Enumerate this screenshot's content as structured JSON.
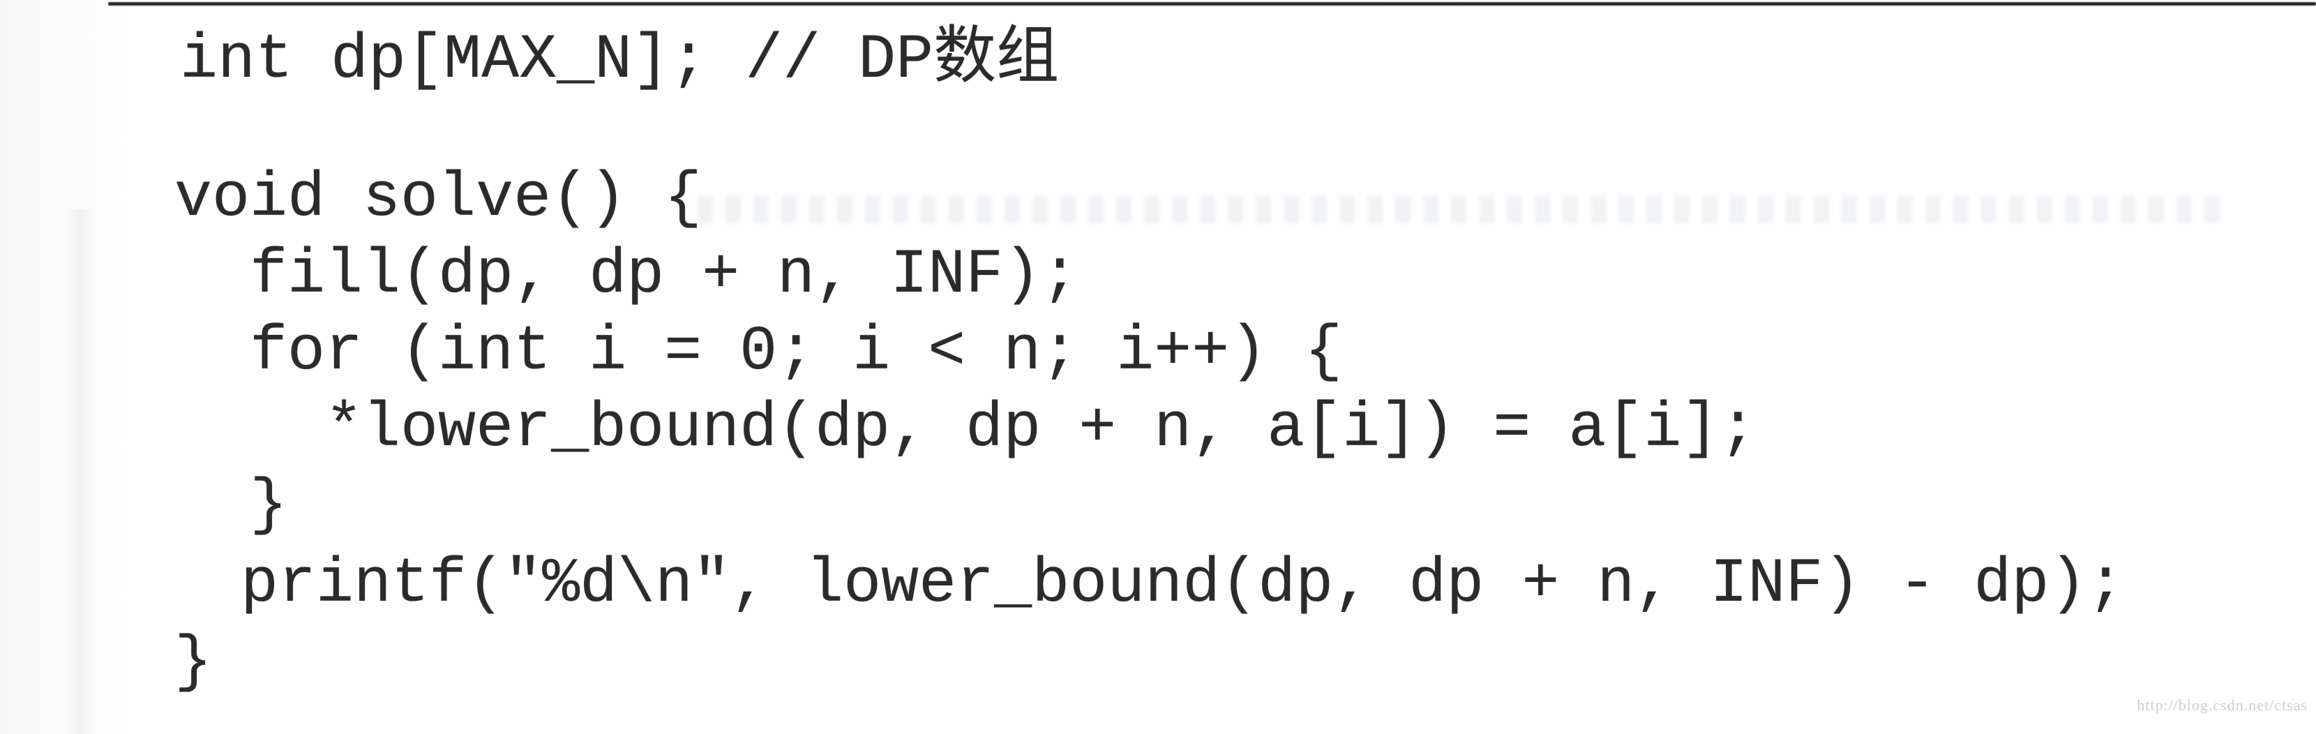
{
  "document": {
    "code_lines": [
      "int dp[MAX_N]; // DP数组",
      "void solve() {",
      "  fill(dp, dp + n, INF);",
      "  for (int i = 0; i < n; i++) {",
      "    *lower_bound(dp, dp + n, a[i]) = a[i];",
      "  }",
      "  printf(\"%d\\n\", lower_bound(dp, dp + n, INF) - dp);",
      "}"
    ],
    "watermark": "http://blog.csdn.net/ctsas"
  }
}
